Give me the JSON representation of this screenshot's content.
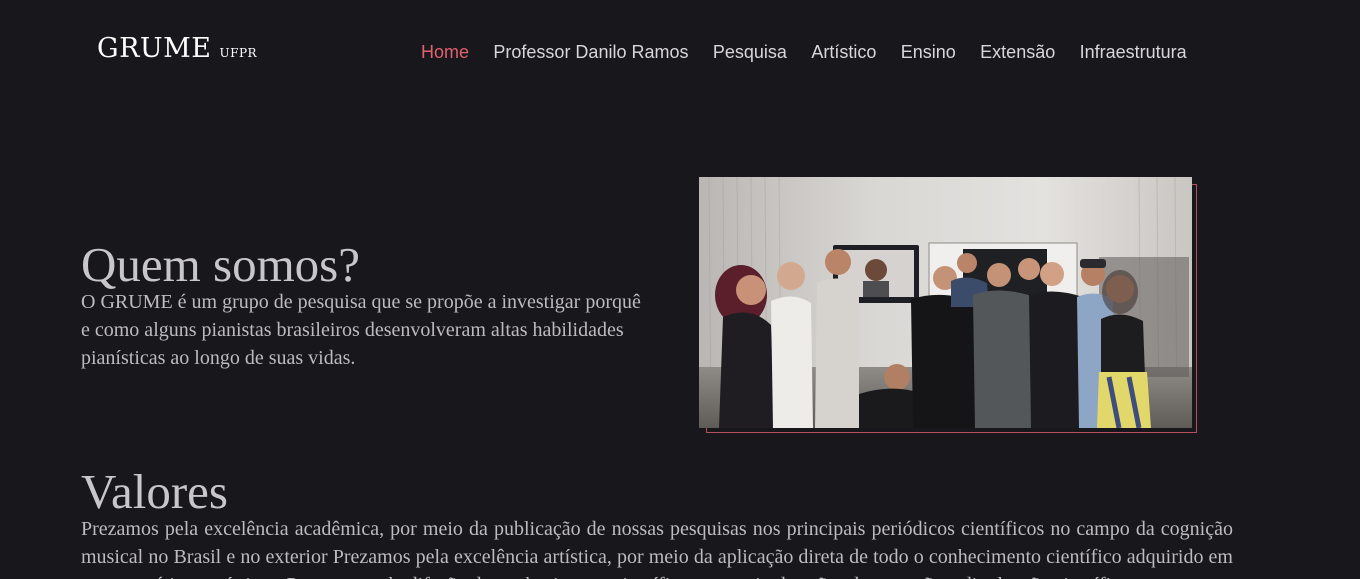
{
  "header": {
    "logo_main": "GRUME",
    "logo_sub": "UFPR",
    "nav": [
      {
        "label": "Home",
        "active": true
      },
      {
        "label": "Professor Danilo Ramos",
        "active": false
      },
      {
        "label": "Pesquisa",
        "active": false
      },
      {
        "label": "Artístico",
        "active": false
      },
      {
        "label": "Ensino",
        "active": false
      },
      {
        "label": "Extensão",
        "active": false
      },
      {
        "label": "Infraestrutura",
        "active": false
      }
    ]
  },
  "intro": {
    "title": "Quem somos?",
    "text": "O GRUME é um grupo de pesquisa que se propõe a investigar porquê e como alguns pianistas brasileiros desenvolveram altas habilidades pianísticas ao longo de suas vidas."
  },
  "values": {
    "title": "Valores",
    "text": "Prezamos pela excelência acadêmica, por meio da publicação de nossas pesquisas nos principais periódicos científicos no campo da cognição musical no Brasil e no exterior Prezamos pela excelência artística, por meio da aplicação direta de todo o conhecimento científico adquirido em nossas práticas artísticas. Prezamos pela difusão do conhecimento científico, por meio de ações de extensão e divulgação científica."
  },
  "colors": {
    "background": "#18171b",
    "accent": "#e0626e",
    "frame": "#b8505c",
    "text": "#c8c6cb"
  }
}
